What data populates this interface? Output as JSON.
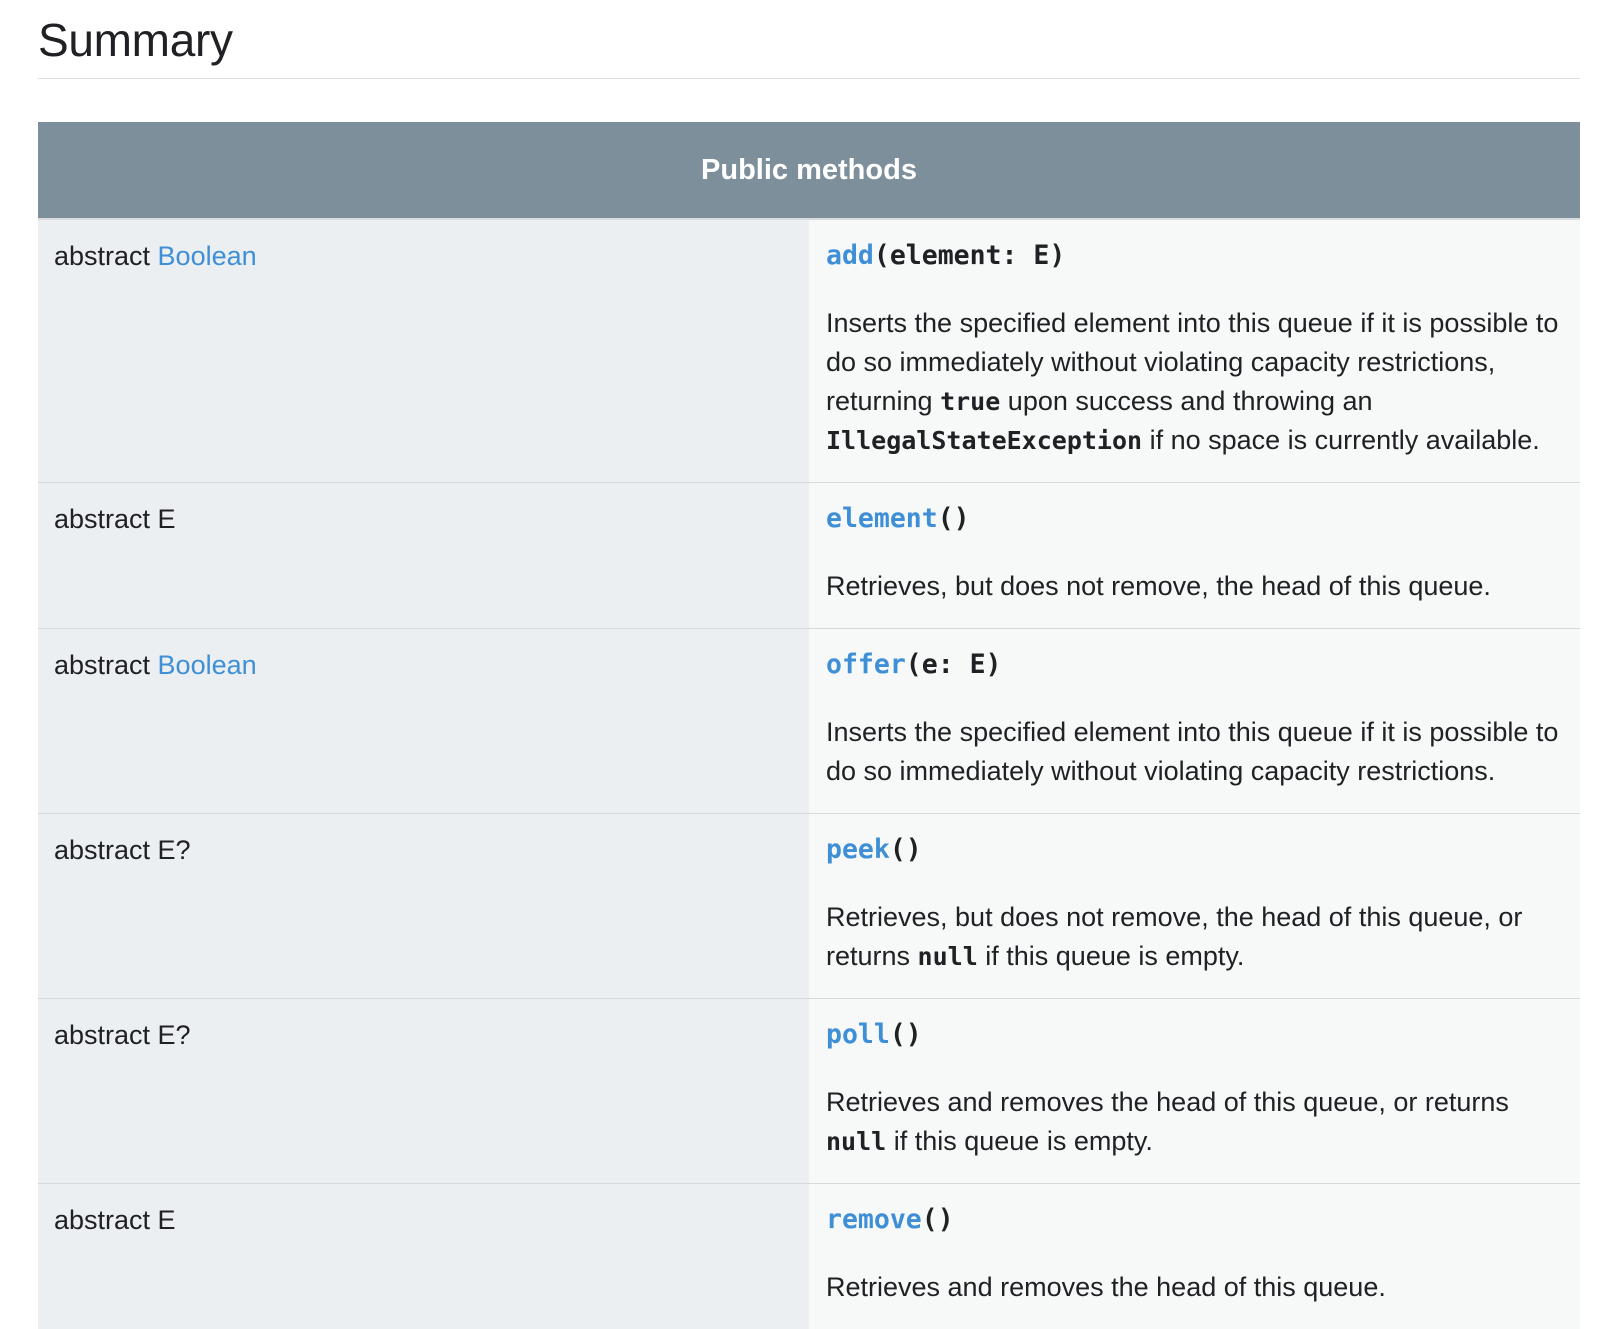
{
  "page": {
    "title": "Summary"
  },
  "table": {
    "header": "Public methods",
    "rows": [
      {
        "type_prefix": "abstract ",
        "type_link": "Boolean",
        "method_name": "add",
        "method_params": "(element: E)",
        "desc_1": "Inserts the specified element into this queue if it is possible to do so immediately without violating capacity restrictions, returning ",
        "code_1": "true",
        "desc_2": " upon success and throwing an ",
        "code_2": "IllegalStateException",
        "desc_3": " if no space is currently available."
      },
      {
        "type_prefix": "abstract E",
        "method_name": "element",
        "method_params": "()",
        "desc_1": "Retrieves, but does not remove, the head of this queue."
      },
      {
        "type_prefix": "abstract ",
        "type_link": "Boolean",
        "method_name": "offer",
        "method_params": "(e: E)",
        "desc_1": "Inserts the specified element into this queue if it is possible to do so immediately without violating capacity restrictions."
      },
      {
        "type_prefix": "abstract E?",
        "method_name": "peek",
        "method_params": "()",
        "desc_1": "Retrieves, but does not remove, the head of this queue, or returns ",
        "code_1": "null",
        "desc_2": " if this queue is empty."
      },
      {
        "type_prefix": "abstract E?",
        "method_name": "poll",
        "method_params": "()",
        "desc_1": "Retrieves and removes the head of this queue, or returns ",
        "code_1": "null",
        "desc_2": " if this queue is empty."
      },
      {
        "type_prefix": "abstract E",
        "method_name": "remove",
        "method_params": "()",
        "desc_1": "Retrieves and removes the head of this queue."
      }
    ]
  },
  "colors": {
    "header_background": "#7c8f9b",
    "link": "#3f8fd6",
    "type_column_background": "#eceff1",
    "signature_column_background": "#f7f9f9"
  }
}
